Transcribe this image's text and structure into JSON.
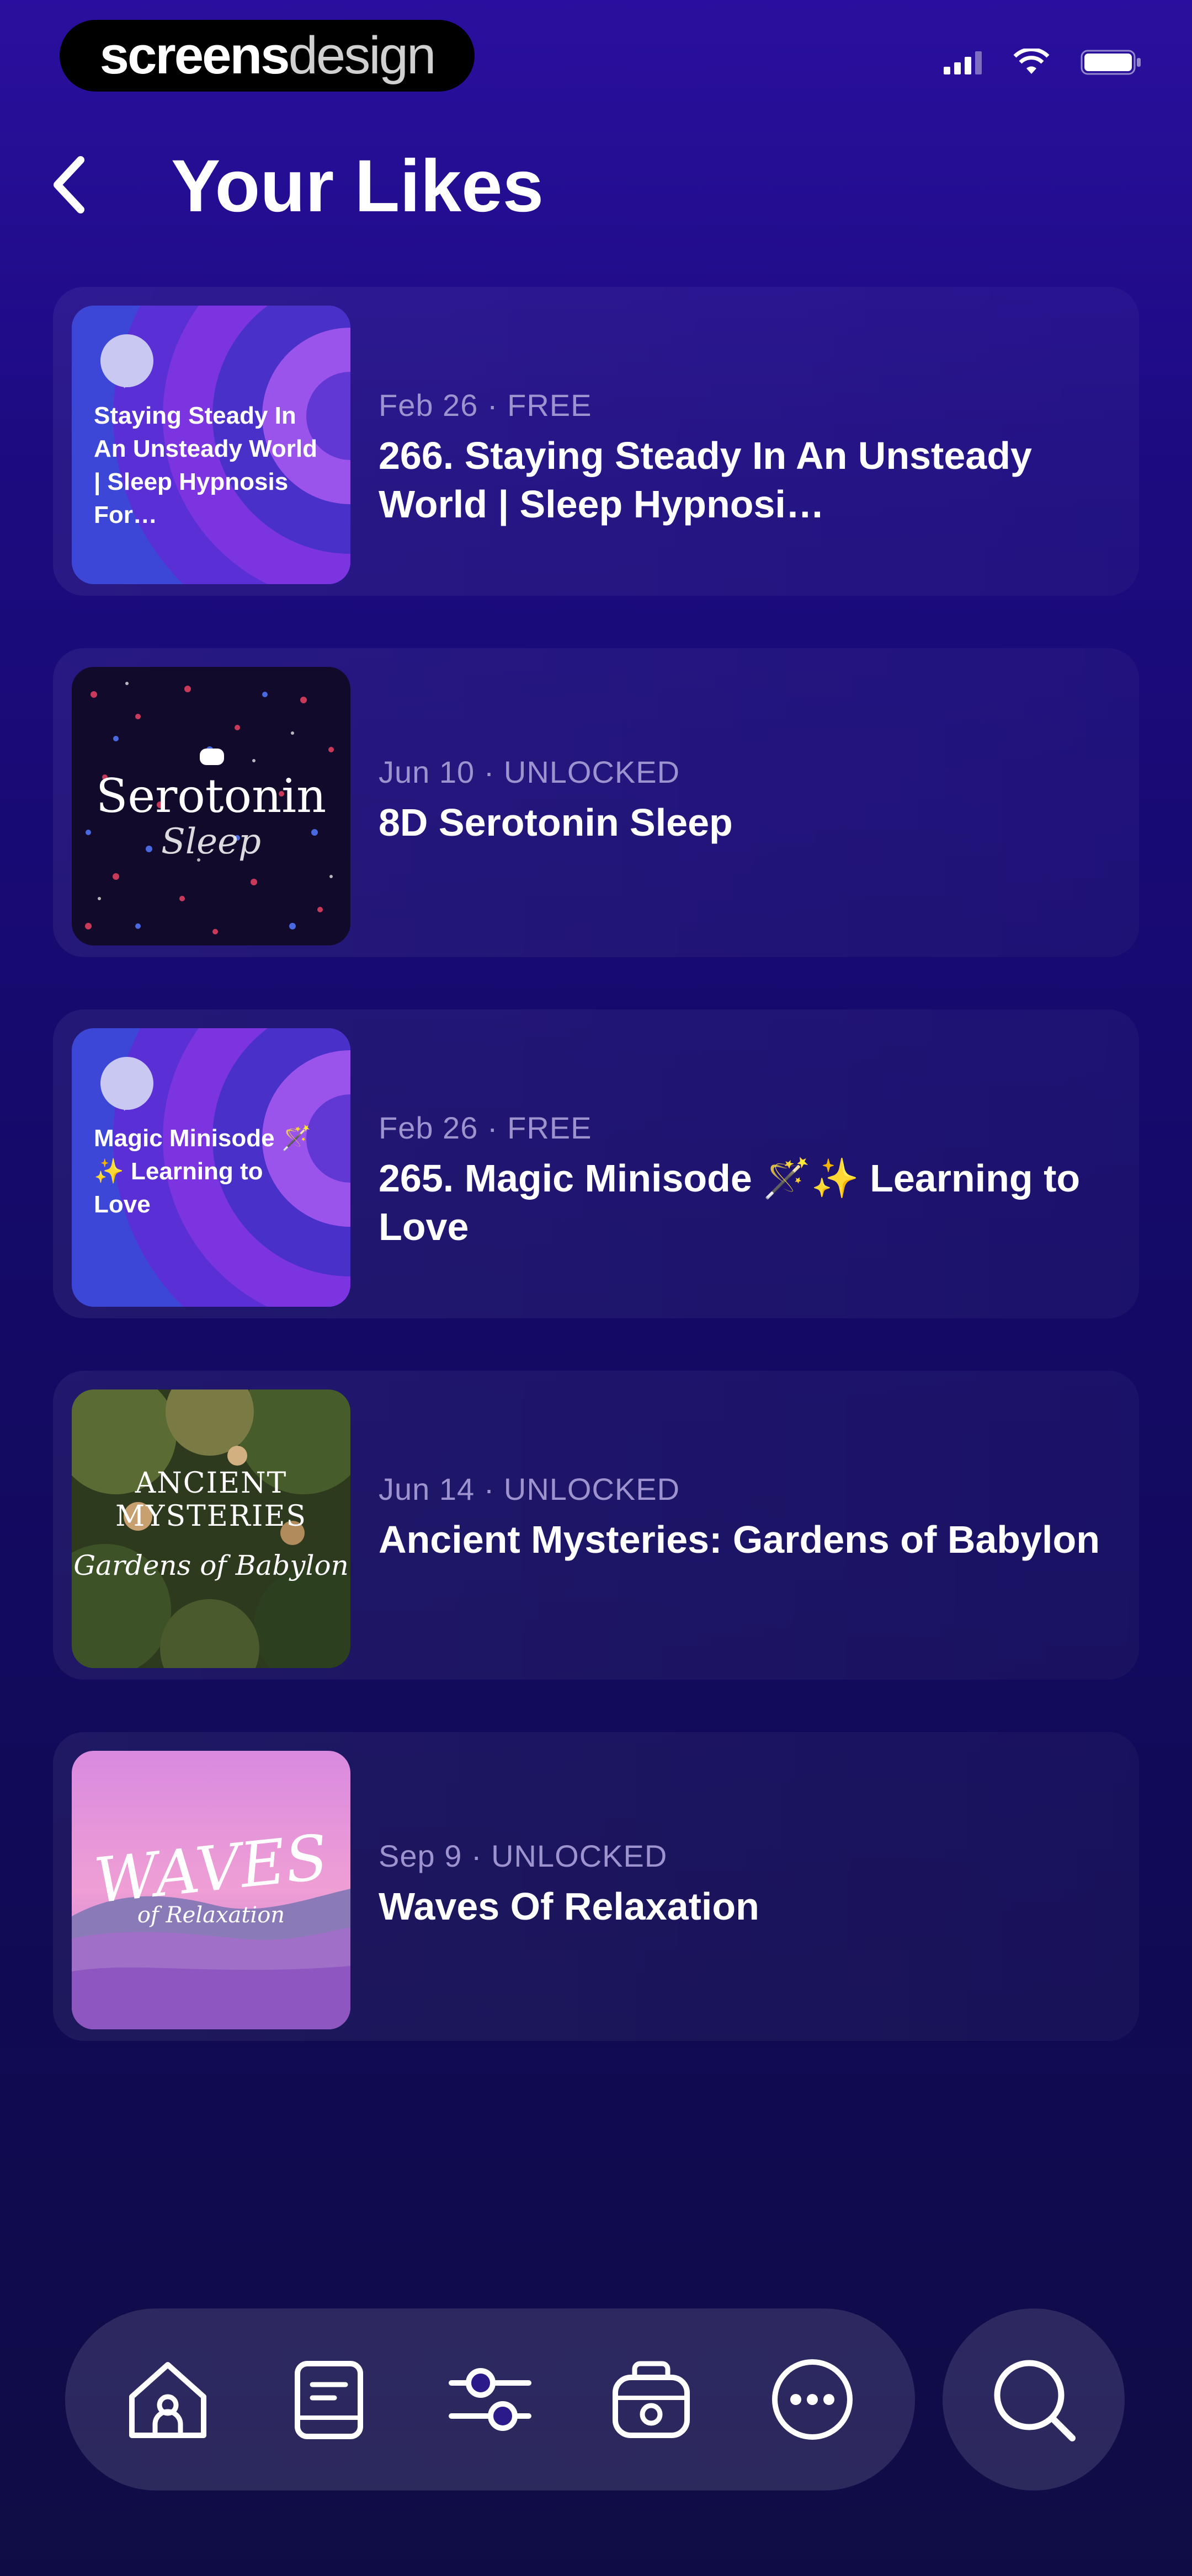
{
  "status_bar": {
    "badge_bold": "screens",
    "badge_light": "design"
  },
  "header": {
    "title": "Your Likes"
  },
  "episodes": [
    {
      "date": "Feb 26 · FREE",
      "title": "266. Staying Steady In An Unsteady World | Sleep Hypnosi…",
      "thumb_type": "swirl",
      "thumb_text": "Staying Steady In An Unsteady World | Sleep Hypnosis For…"
    },
    {
      "date": "Jun 10 · UNLOCKED",
      "title": "8D Serotonin Sleep",
      "thumb_type": "stars",
      "thumb_text": "Serotonin",
      "thumb_text2": "Sleep"
    },
    {
      "date": "Feb 26 · FREE",
      "title": "265. Magic Minisode 🪄✨ Learning to Love",
      "thumb_type": "swirl",
      "thumb_text": "Magic Minisode 🪄✨ Learning to Love"
    },
    {
      "date": "Jun 14 · UNLOCKED",
      "title": "Ancient Mysteries: Gardens of Babylon",
      "thumb_type": "garden",
      "thumb_text": "ANCIENT MYSTERIES",
      "thumb_text2": "Gardens of Babylon"
    },
    {
      "date": "Sep 9 · UNLOCKED",
      "title": "Waves Of Relaxation",
      "thumb_type": "waves",
      "thumb_text": "WAVES",
      "thumb_text2": "of Relaxation"
    }
  ],
  "tabbar": {
    "items": [
      {
        "icon": "home-icon"
      },
      {
        "icon": "library-icon"
      },
      {
        "icon": "sliders-icon"
      },
      {
        "icon": "radio-icon"
      },
      {
        "icon": "more-icon"
      }
    ],
    "search_icon": "search-icon"
  },
  "colors": {
    "background_top": "#2a0f9e",
    "background_bottom": "#0f0c45",
    "meta_text": "#9c93cf"
  }
}
